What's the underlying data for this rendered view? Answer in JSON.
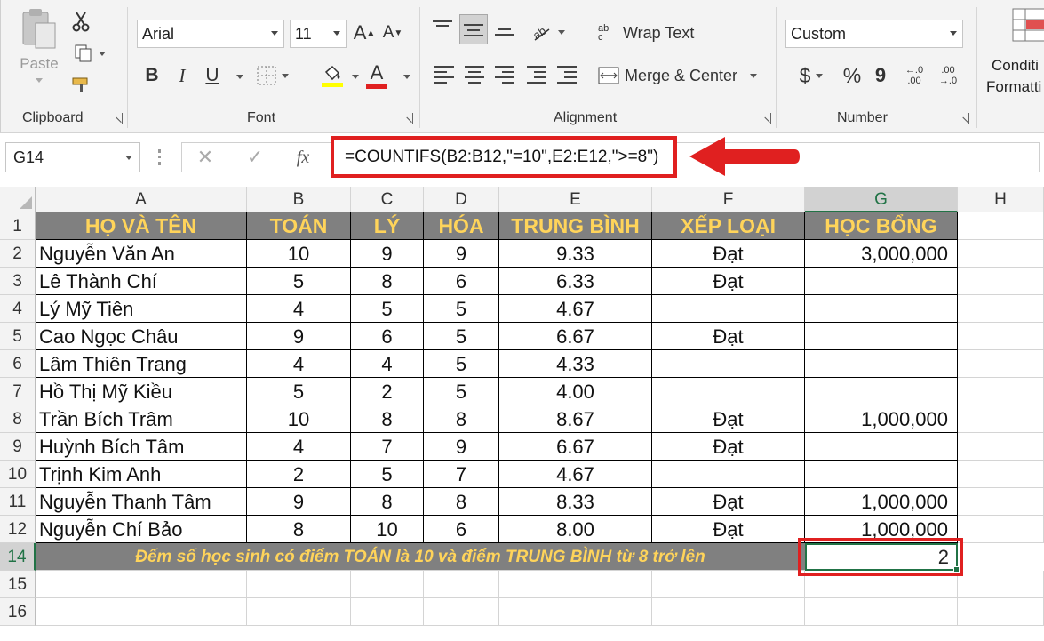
{
  "ribbon": {
    "clipboard": {
      "paste_label": "Paste",
      "group_label": "Clipboard"
    },
    "font": {
      "font_name": "Arial",
      "font_size": "11",
      "bold": "B",
      "italic": "I",
      "underline": "U",
      "group_label": "Font",
      "grow_font": "A",
      "shrink_font": "A",
      "font_color": "A"
    },
    "alignment": {
      "wrap_text": "Wrap Text",
      "merge_center": "Merge & Center",
      "group_label": "Alignment",
      "wrap_icon": "ab\nc"
    },
    "number": {
      "format": "Custom",
      "currency": "$",
      "percent": "%",
      "comma": "9",
      "inc_decimal": "←.0\n.00",
      "dec_decimal": ".00\n→.0",
      "group_label": "Number"
    },
    "styles": {
      "conditional_line1": "Conditi",
      "conditional_line2": "Formatti"
    }
  },
  "formula_bar": {
    "name_box": "G14",
    "fx": "fx",
    "cancel": "✕",
    "enter": "✓",
    "formula": "=COUNTIFS(B2:B12,\"=10\",E2:E12,\">=8\")"
  },
  "columns": [
    "A",
    "B",
    "C",
    "D",
    "E",
    "F",
    "G",
    "H"
  ],
  "row_numbers": [
    "1",
    "2",
    "3",
    "4",
    "5",
    "6",
    "7",
    "8",
    "9",
    "10",
    "11",
    "12",
    "14",
    "15",
    "16"
  ],
  "headers": [
    "HỌ VÀ TÊN",
    "TOÁN",
    "LÝ",
    "HÓA",
    "TRUNG BÌNH",
    "XẾP LOẠI",
    "HỌC BỔNG"
  ],
  "rows": [
    [
      "Nguyễn Văn An",
      "10",
      "9",
      "9",
      "9.33",
      "Đạt",
      "3,000,000"
    ],
    [
      "Lê Thành Chí",
      "5",
      "8",
      "6",
      "6.33",
      "Đạt",
      ""
    ],
    [
      "Lý Mỹ Tiên",
      "4",
      "5",
      "5",
      "4.67",
      "",
      ""
    ],
    [
      "Cao Ngọc Châu",
      "9",
      "6",
      "5",
      "6.67",
      "Đạt",
      ""
    ],
    [
      "Lâm Thiên Trang",
      "4",
      "4",
      "5",
      "4.33",
      "",
      ""
    ],
    [
      "Hồ Thị Mỹ Kiều",
      "5",
      "2",
      "5",
      "4.00",
      "",
      ""
    ],
    [
      "Trần Bích Trâm",
      "10",
      "8",
      "8",
      "8.67",
      "Đạt",
      "1,000,000"
    ],
    [
      "Huỳnh Bích Tâm",
      "4",
      "7",
      "9",
      "6.67",
      "Đạt",
      ""
    ],
    [
      "Trịnh Kim Anh",
      "2",
      "5",
      "7",
      "4.67",
      "",
      ""
    ],
    [
      "Nguyễn Thanh Tâm",
      "9",
      "8",
      "8",
      "8.33",
      "Đạt",
      "1,000,000"
    ],
    [
      "Nguyễn Chí Bảo",
      "8",
      "10",
      "6",
      "8.00",
      "Đạt",
      "1,000,000"
    ]
  ],
  "summary": {
    "label": "Đếm số học sinh có điểm TOÁN là 10 và điểm TRUNG BÌNH từ 8 trở lên",
    "result": "2"
  },
  "colors": {
    "accent_red": "#e02020",
    "header_bg": "#808080",
    "header_text": "#ffd45a",
    "selection_green": "#217346"
  }
}
